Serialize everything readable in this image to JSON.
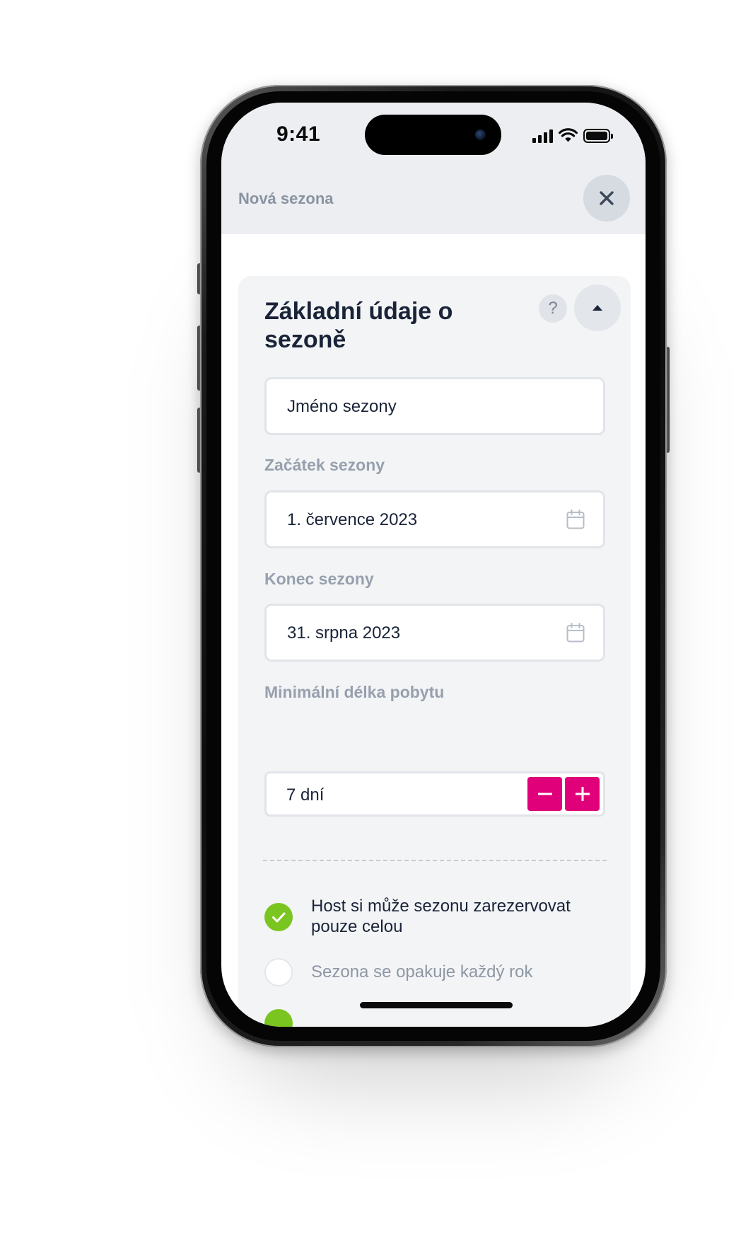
{
  "status_bar": {
    "time": "9:41",
    "icons": [
      "cellular-signal-icon",
      "wifi-icon",
      "battery-icon"
    ]
  },
  "sheet": {
    "title": "Nová sezona",
    "close_icon": "close-icon"
  },
  "card": {
    "title": "Základní údaje o sezoně",
    "help_label": "?",
    "collapse_icon": "chevron-up-icon"
  },
  "form": {
    "season_name": {
      "value": "Jméno sezony"
    },
    "start": {
      "label": "Začátek sezony",
      "value": "1. července 2023",
      "icon": "calendar-icon"
    },
    "end": {
      "label": "Konec sezony",
      "value": "31. srpna 2023",
      "icon": "calendar-icon"
    },
    "min_stay": {
      "label": "Minimální délka pobytu",
      "value": "7 dní",
      "decrement_label": "−",
      "increment_label": "+"
    }
  },
  "options": [
    {
      "label": "Host si může sezonu zarezervovat pouze celou",
      "checked": true
    },
    {
      "label": "Sezona se opakuje každý rok",
      "checked": false
    }
  ],
  "colors": {
    "accent": "#e0007a",
    "check": "#7ac51f",
    "title": "#1a2438",
    "label": "#97a0ad",
    "header_bg": "#eceef1",
    "card_bg": "#f3f4f6"
  }
}
